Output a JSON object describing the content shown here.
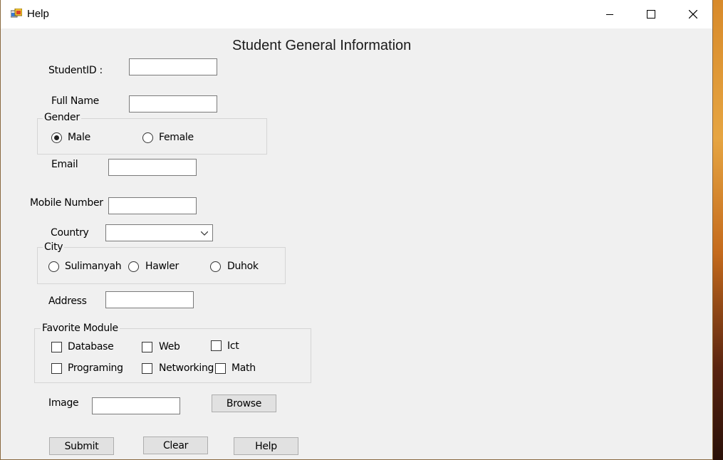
{
  "window": {
    "title": "Help"
  },
  "form": {
    "title": "Student General Information",
    "student_id_label": "StudentID :",
    "full_name_label": "Full Name",
    "gender": {
      "legend": "Gender",
      "male": "Male",
      "female": "Female",
      "selected": "Male"
    },
    "email_label": "Email",
    "mobile_label": "Mobile Number",
    "country_label": "Country",
    "country_value": "",
    "city": {
      "legend": "City",
      "options": [
        "Sulimanyah",
        "Hawler",
        "Duhok"
      ]
    },
    "address_label": "Address",
    "favorite_module": {
      "legend": "Favorite Module",
      "options": [
        "Database",
        "Web",
        "Ict",
        "Programing",
        "Networking",
        "Math"
      ]
    },
    "image_label": "Image",
    "browse_label": "Browse",
    "submit_label": "Submit",
    "clear_label": "Clear",
    "help_label": "Help"
  }
}
